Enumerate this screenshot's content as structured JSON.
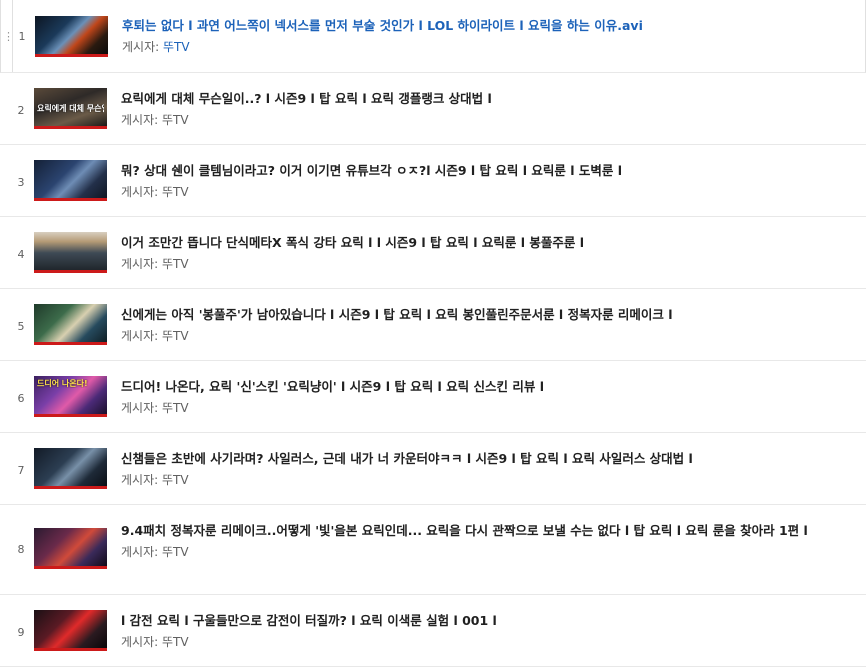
{
  "playlist": {
    "by_prefix": "게시자:",
    "items": [
      {
        "index": "1",
        "title": "후퇴는 없다 l 과연 어느쪽이 넥서스를 먼저 부술 것인가 l LOL 하이라이트 l 요릭을 하는 이유.avi",
        "channel": "뚜TV",
        "thumb_caption": "",
        "active": true
      },
      {
        "index": "2",
        "title": "요릭에게 대체 무슨일이..? l 시즌9 l 탑 요릭 l 요릭 갱플랭크 상대법 l",
        "channel": "뚜TV",
        "thumb_caption": "요릭에게 대체 무슨일이?",
        "active": false
      },
      {
        "index": "3",
        "title": "뭐? 상대 쉔이 클템님이라고? 이거 이기면 유튜브각 ㅇㅈ?l 시즌9 l 탑 요릭 l 요릭룬 l 도벽룬 l",
        "channel": "뚜TV",
        "thumb_caption": "",
        "active": false
      },
      {
        "index": "4",
        "title": "이거 조만간 뜹니다 단식메타X 폭식 강타 요릭 l l 시즌9 l 탑 요릭 l 요릭룬 l 봉풀주룬 l",
        "channel": "뚜TV",
        "thumb_caption": "",
        "active": false
      },
      {
        "index": "5",
        "title": "신에게는 아직 '봉풀주'가 남아있습니다 l 시즌9 l 탑 요릭 l 요릭 봉인풀린주문서룬 l 정복자룬 리메이크 l",
        "channel": "뚜TV",
        "thumb_caption": "",
        "active": false
      },
      {
        "index": "6",
        "title": "드디어! 나온다, 요릭 '신'스킨 '요릭냥이' l 시즌9 l 탑 요릭 l 요릭 신스킨 리뷰 l",
        "channel": "뚜TV",
        "thumb_caption": "드디어 나온다!",
        "active": false
      },
      {
        "index": "7",
        "title": "신챔들은 초반에 사기라며? 사일러스, 근데 내가 너 카운터야ㅋㅋ l 시즌9 l 탑 요릭 l 요릭 사일러스 상대법 l",
        "channel": "뚜TV",
        "thumb_caption": "",
        "active": false
      },
      {
        "index": "8",
        "title": "9.4패치 정복자룬 리메이크..어떻게 '빛'을본 요릭인데... 요릭을 다시 관짝으로 보낼 수는 없다 l 탑 요릭 l 요릭 룬을 찾아라 1편 l",
        "channel": "뚜TV",
        "thumb_caption": "",
        "active": false
      },
      {
        "index": "9",
        "title": "l 감전 요릭 l 구울들만으로 감전이 터질까? l 요릭 이색룬 실험 l 001 l",
        "channel": "뚜TV",
        "thumb_caption": "",
        "active": false
      }
    ]
  }
}
